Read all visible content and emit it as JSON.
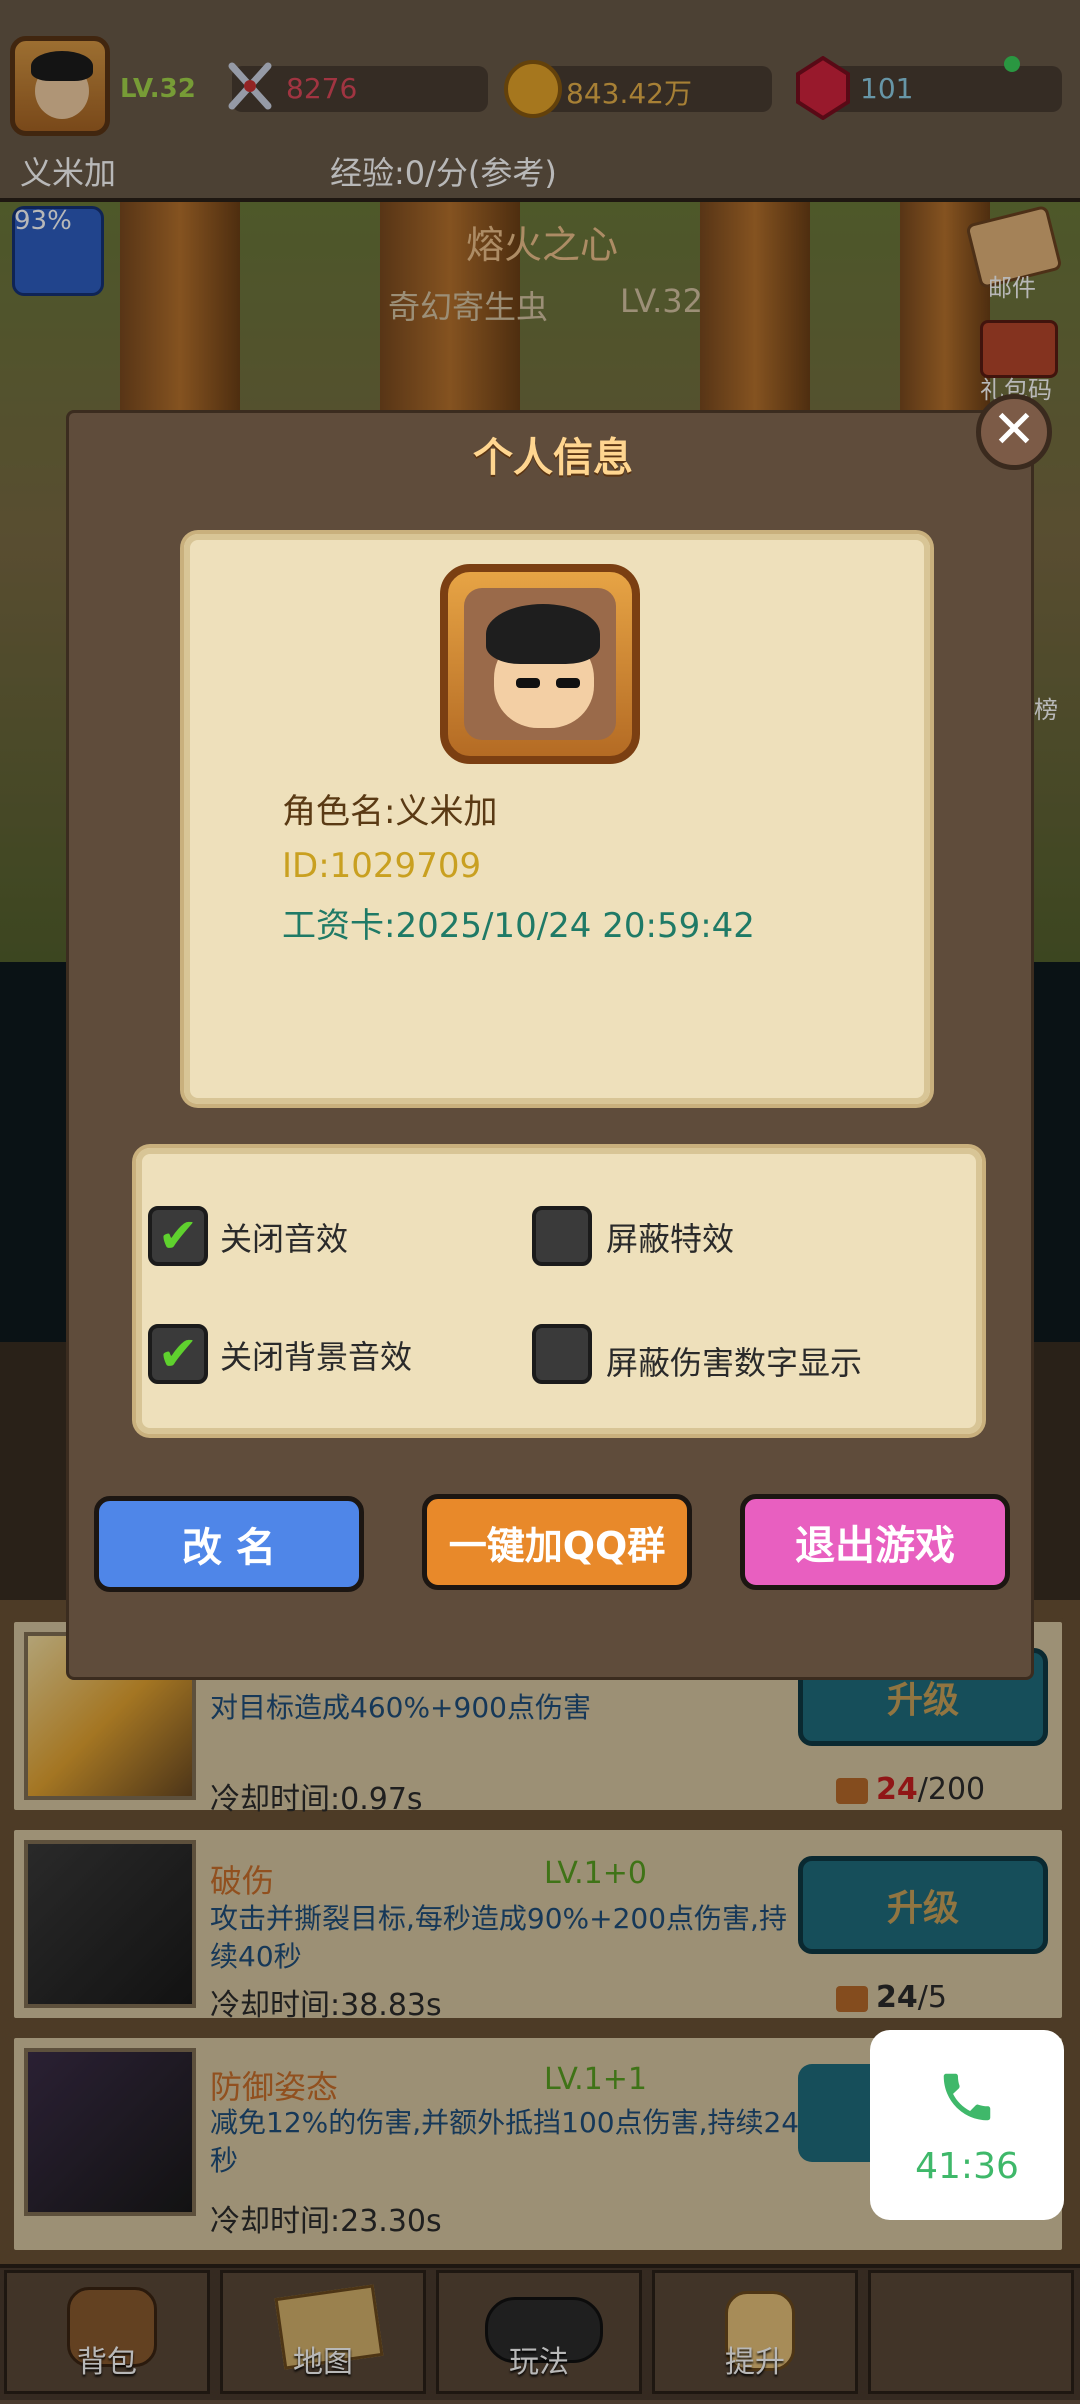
{
  "hud": {
    "level": "LV.32",
    "player_name": "义米加",
    "combat_power": "8276",
    "gold": "843.42万",
    "gems": "101",
    "exp_rate": "经验:0/分(参考)",
    "exp_percent": "93%"
  },
  "stage": {
    "title": "熔火之心",
    "enemy_name": "奇幻寄生虫",
    "enemy_level": "LV.32"
  },
  "side_menu": {
    "mail_label": "邮件",
    "gift_label": "礼包码",
    "rank_label": "榜"
  },
  "dialog": {
    "title": "个人信息",
    "role_name": "角色名:义米加",
    "id": "ID:1029709",
    "salary_card": "工资卡:2025/10/24 20:59:42",
    "options": [
      {
        "label": "关闭音效",
        "checked": true
      },
      {
        "label": "屏蔽特效",
        "checked": false
      },
      {
        "label": "关闭背景音效",
        "checked": true
      },
      {
        "label": "屏蔽伤害数字显示",
        "checked": false
      }
    ],
    "buttons": {
      "rename": "改 名",
      "join_qq": "一键加QQ群",
      "exit": "退出游戏"
    }
  },
  "skills": [
    {
      "name": "",
      "level": "",
      "desc": "对目标造成460%+900点伤害",
      "cooldown": "冷却时间:0.97s",
      "cost_have": "24",
      "cost_need": "/200",
      "action": "升级"
    },
    {
      "name": "破伤",
      "level": "LV.1+0",
      "desc": "攻击并撕裂目标,每秒造成90%+200点伤害,持续40秒",
      "cooldown": "冷却时间:38.83s",
      "cost_have": "24",
      "cost_need": "/5",
      "action": "升级"
    },
    {
      "name": "防御姿态",
      "level": "LV.1+1",
      "desc": "减免12%的伤害,并额外抵挡100点伤害,持续24秒",
      "cooldown": "冷却时间:23.30s",
      "cost_have": "",
      "cost_need": "",
      "action": ""
    }
  ],
  "bottom_nav": [
    "背包",
    "地图",
    "玩法",
    "提升",
    ""
  ],
  "call": {
    "time": "41:36"
  },
  "colors": {
    "accent_green": "#a6d94b",
    "rename": "#4f86e8",
    "join_qq": "#e8892a",
    "exit": "#e85fc0",
    "upgrade": "#1f6c7d"
  }
}
